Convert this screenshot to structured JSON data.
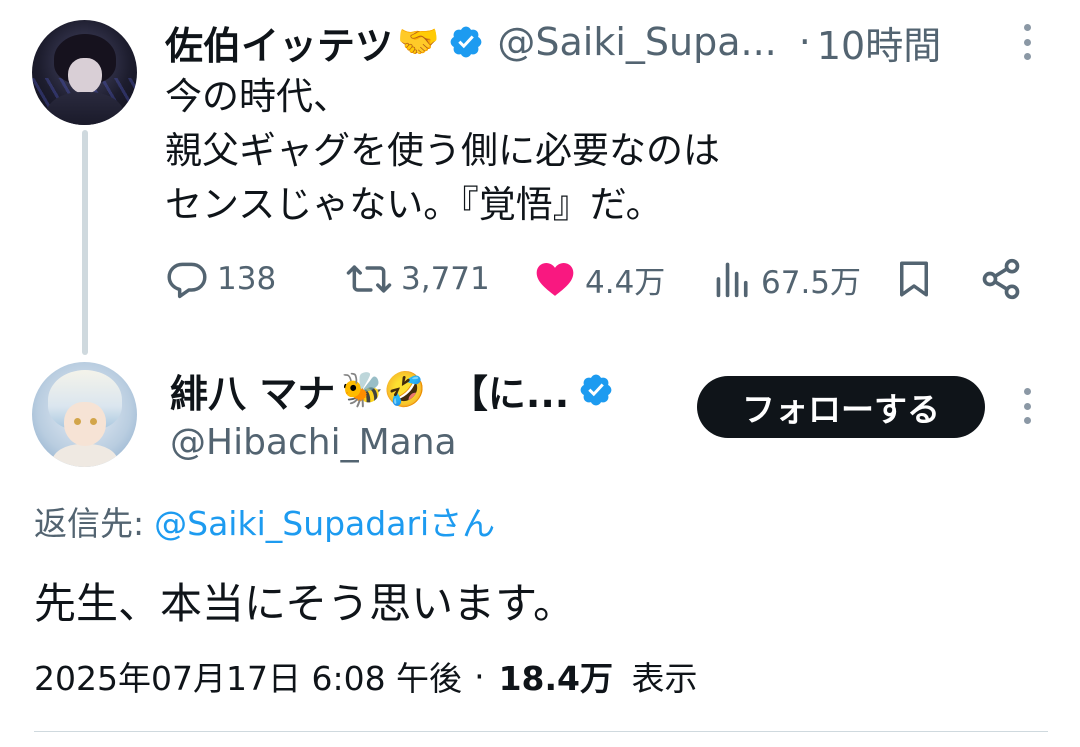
{
  "parent_tweet": {
    "author_name": "佐伯イッテツ",
    "author_emoji": "🤝",
    "handle": "@Saiki_Supa...",
    "separator": "·",
    "time": "10時間",
    "text_lines": [
      "今の時代、",
      "親父ギャグを使う側に必要なのは",
      "センスじゃない。『覚悟』だ。"
    ],
    "actions": {
      "reply_count": "138",
      "retweet_count": "3,771",
      "like_count": "4.4万",
      "view_count": "67.5万"
    }
  },
  "reply_tweet": {
    "author_name": "緋八 マナ",
    "author_emojis": "🐝🤣",
    "name_suffix": "【に...",
    "handle": "@Hibachi_Mana",
    "follow_label": "フォローする",
    "reply_to_label": "返信先:",
    "reply_to_mention": "@Saiki_Supadariさん",
    "text": "先生、本当にそう思います。",
    "timestamp": "2025年07月17日 6:08 午後",
    "separator": "·",
    "views_count": "18.4万",
    "views_label": "表示"
  },
  "colors": {
    "verified_blue": "#1d9bf0",
    "like_pink": "#f91880",
    "muted_gray": "#536471",
    "text_black": "#0f1419"
  }
}
